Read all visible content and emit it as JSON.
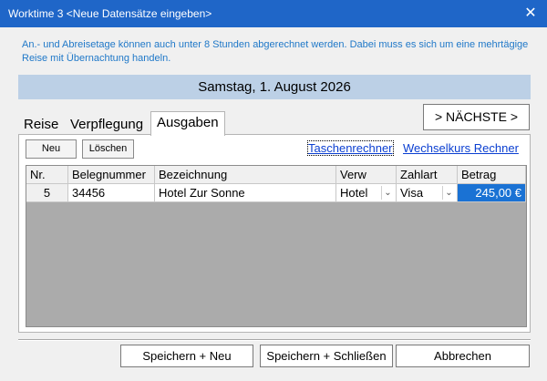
{
  "window": {
    "title": "Worktime 3 <Neue Datensätze eingeben>",
    "close_label": "✕"
  },
  "info_text": "An.- und Abreisetage können auch unter 8 Stunden abgerechnet werden. Dabei muss es sich um eine mehrtägige Reise mit Übernachtung handeln.",
  "date_label": "Samstag, 1. August 2026",
  "tabs": [
    {
      "label": "Reise"
    },
    {
      "label": "Verpflegung"
    },
    {
      "label": "Ausgaben",
      "active": true
    }
  ],
  "next_button": "> NÄCHSTE >",
  "toolbar": {
    "new_label": "Neu",
    "delete_label": "Löschen"
  },
  "links": {
    "calculator": "Taschenrechner",
    "exchange": "Wechselkurs Rechner"
  },
  "table": {
    "columns": [
      "Nr.",
      "Belegnummer",
      "Bezeichnung",
      "Verw",
      "Zahlart",
      "Betrag"
    ],
    "rows": [
      {
        "nr": "5",
        "belegnummer": "34456",
        "bezeichnung": "Hotel Zur Sonne",
        "verw": "Hotel",
        "zahlart": "Visa",
        "betrag": "245,00 €"
      }
    ]
  },
  "icons": {
    "combo": "chevron-down-icon",
    "close": "close-icon"
  },
  "footer": {
    "save_new": "Speichern + Neu",
    "save_close": "Speichern + Schließen",
    "cancel": "Abbrechen"
  },
  "colors": {
    "titlebar": "#1f66c8",
    "info_text": "#1f78c8",
    "date_bar": "#bcd0e6",
    "selection": "#1a72d4",
    "link": "#0b3fd1"
  }
}
